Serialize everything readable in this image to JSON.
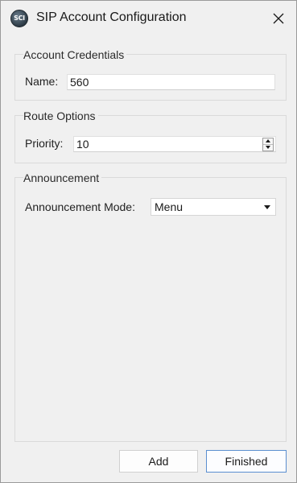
{
  "window": {
    "title": "SIP Account Configuration",
    "app_icon_text": "SCI"
  },
  "groups": {
    "credentials": {
      "title": "Account Credentials",
      "name_label": "Name:",
      "name_value": "560"
    },
    "route": {
      "title": "Route Options",
      "priority_label": "Priority:",
      "priority_value": "10"
    },
    "announcement": {
      "title": "Announcement",
      "mode_label": "Announcement Mode:",
      "mode_value": "Menu"
    }
  },
  "buttons": {
    "add_label": "Add",
    "finished_label": "Finished"
  },
  "icons": {
    "close": "close-icon",
    "spin_up": "chevron-up-icon",
    "spin_down": "chevron-down-icon",
    "dropdown": "dropdown-arrow-icon"
  },
  "colors": {
    "window_bg": "#f0f0f0",
    "default_button_border": "#5b8fd0"
  }
}
